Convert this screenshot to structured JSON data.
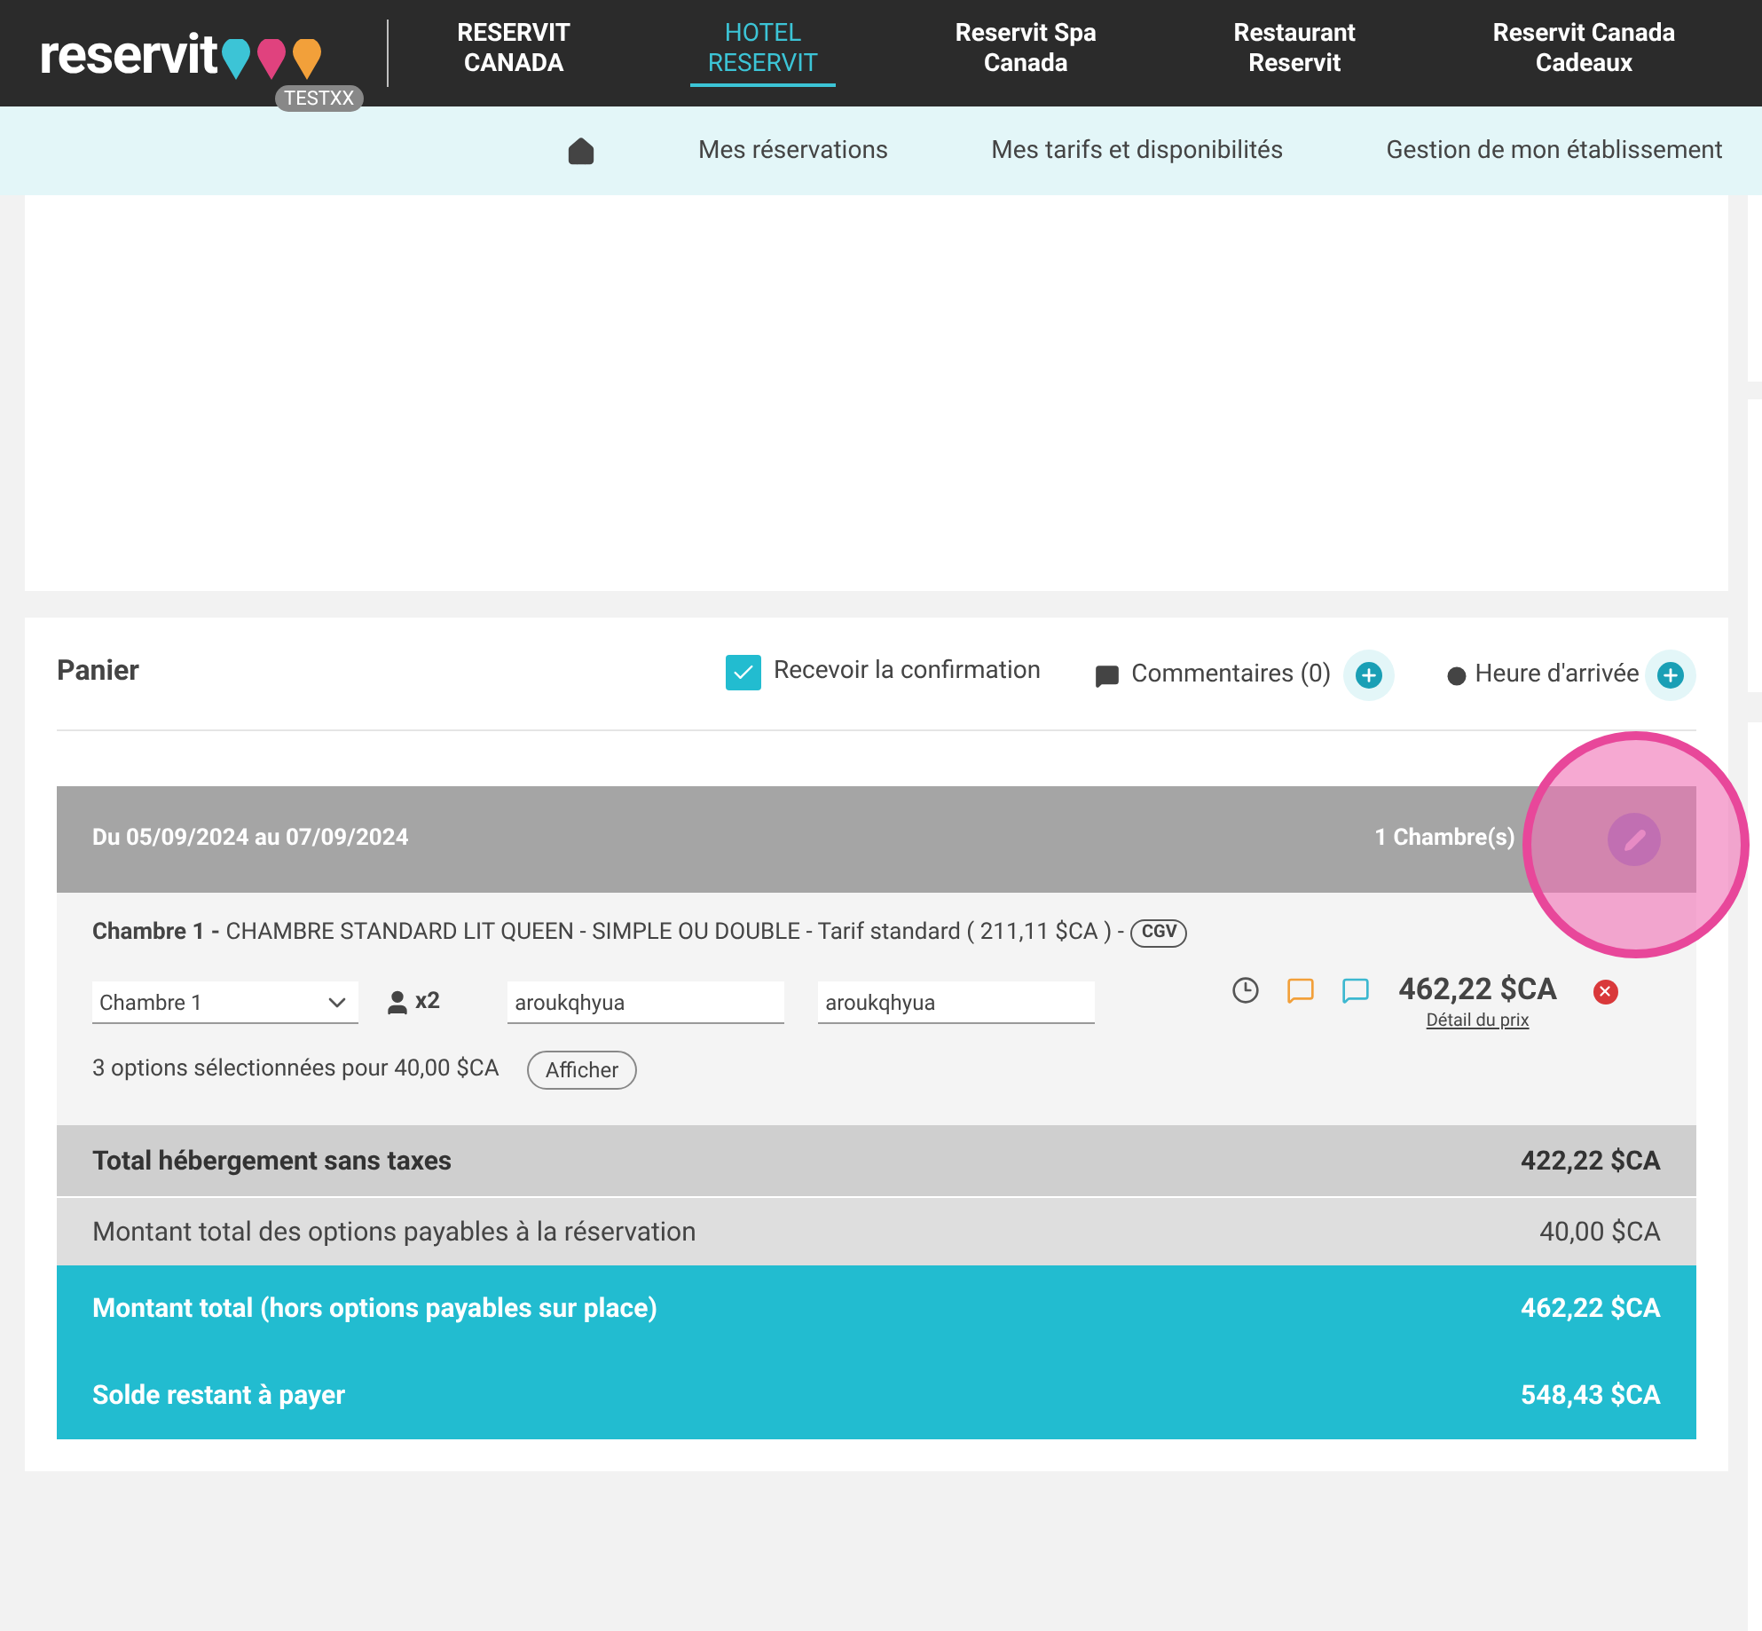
{
  "header": {
    "logo": "reservit",
    "badge": "TESTXX",
    "tabs": [
      {
        "label": "RESERVIT\nCANADA",
        "selected": false
      },
      {
        "label": "HOTEL\nRESERVIT",
        "selected": true
      },
      {
        "label": "Reservit Spa\nCanada",
        "selected": false
      },
      {
        "label": "Restaurant\nReservit",
        "selected": false
      },
      {
        "label": "Reservit Canada\nCadeaux",
        "selected": false
      }
    ]
  },
  "subnav": {
    "items": [
      "Mes réservations",
      "Mes tarifs et disponibilités",
      "Gestion de mon établissement"
    ]
  },
  "cart": {
    "title": "Panier",
    "confirmation": {
      "label": "Recevoir la confirmation",
      "checked": true
    },
    "comments": "Commentaires (0)",
    "arrival": "Heure d'arrivée",
    "stay": {
      "dates": "Du 05/09/2024 au 07/09/2024",
      "rooms": "1 Chambre(s)"
    },
    "room": {
      "title": "Chambre 1 -",
      "desc": "CHAMBRE STANDARD LIT QUEEN - SIMPLE OU DOUBLE - Tarif standard ( 211,11 $CA ) -",
      "cgv": "CGV",
      "select": "Chambre 1",
      "guests": "x2",
      "first_name": "aroukqhyua",
      "last_name": "aroukqhyua",
      "price": "462,22 $CA",
      "price_detail": "Détail du prix",
      "options": "3 options sélectionnées pour 40,00 $CA",
      "show": "Afficher"
    },
    "totals": [
      {
        "label": "Total hébergement sans taxes",
        "value": "422,22 $CA",
        "kind": "subtotal"
      },
      {
        "label": "Montant total des options payables à la réservation",
        "value": "40,00 $CA",
        "kind": "plain"
      },
      {
        "label": "Montant total (hors options payables sur place)",
        "value": "462,22 $CA",
        "kind": "total"
      },
      {
        "label": "Solde restant à payer",
        "value": "548,43 $CA",
        "kind": "total"
      }
    ]
  }
}
